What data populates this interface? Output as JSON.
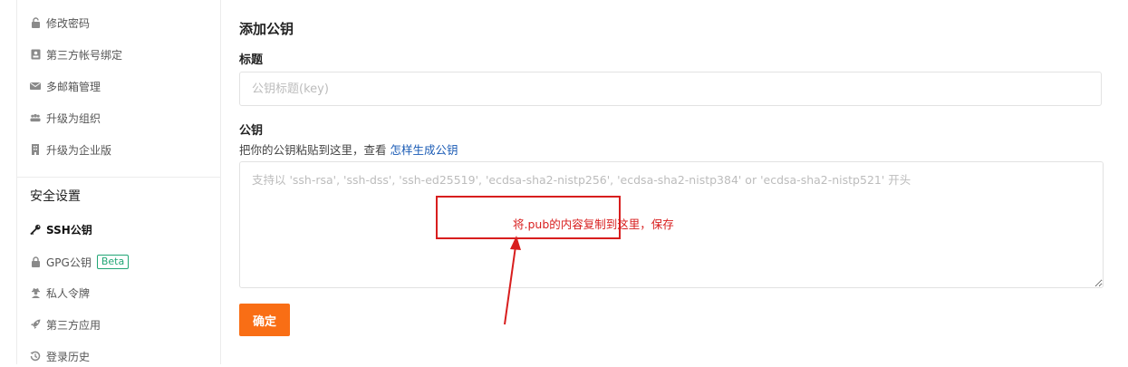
{
  "sidebar": {
    "items_top": [
      {
        "label": "修改密码",
        "icon": "lock-icon"
      },
      {
        "label": "第三方帐号绑定",
        "icon": "id-card-icon"
      },
      {
        "label": "多邮箱管理",
        "icon": "envelope-icon"
      },
      {
        "label": "升级为组织",
        "icon": "users-icon"
      },
      {
        "label": "升级为企业版",
        "icon": "building-icon"
      }
    ],
    "security_section": "安全设置",
    "items_security": [
      {
        "label": "SSH公钥",
        "icon": "key-icon",
        "active": true
      },
      {
        "label": "GPG公钥",
        "icon": "lock-icon",
        "badge": "Beta"
      },
      {
        "label": "私人令牌",
        "icon": "user-secret-icon"
      },
      {
        "label": "第三方应用",
        "icon": "rocket-icon"
      },
      {
        "label": "登录历史",
        "icon": "history-icon"
      }
    ]
  },
  "form": {
    "page_title": "添加公钥",
    "title_label": "标题",
    "title_placeholder": "公钥标题(key)",
    "key_label": "公钥",
    "key_hint_prefix": "把你的公钥粘贴到这里，查看",
    "key_hint_link": "怎样生成公钥",
    "key_placeholder": "支持以 'ssh-rsa', 'ssh-dss', 'ssh-ed25519', 'ecdsa-sha2-nistp256', 'ecdsa-sha2-nistp384' or 'ecdsa-sha2-nistp521' 开头",
    "submit_label": "确定"
  },
  "annotation": {
    "text": "将.pub的内容复制到这里，保存",
    "color": "#d81e1e"
  },
  "colors": {
    "accent": "#f96e15",
    "link": "#1a5bb5",
    "badge": "#21a675"
  }
}
